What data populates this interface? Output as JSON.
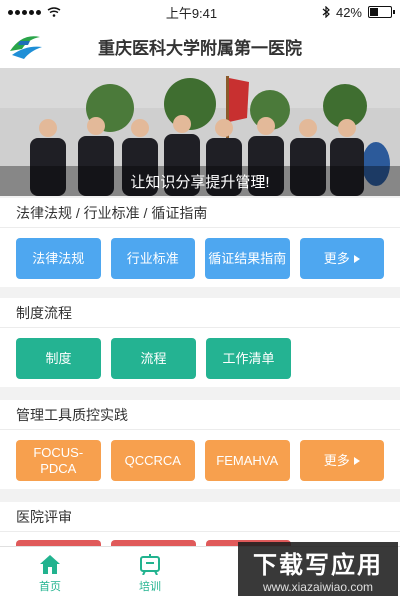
{
  "status": {
    "time": "上午9:41",
    "battery": "42%",
    "battery_fraction": 0.42
  },
  "header": {
    "title": "重庆医科大学附属第一医院"
  },
  "banner": {
    "caption": "让知识分享提升管理!"
  },
  "sections": {
    "law": {
      "title": "法律法规 / 行业标准 / 循证指南",
      "buttons": [
        "法律法规",
        "行业标准",
        "循证结果指南",
        "更多"
      ]
    },
    "process": {
      "title": "制度流程",
      "buttons": [
        "制度",
        "流程",
        "工作清单"
      ]
    },
    "tools": {
      "title": "管理工具质控实践",
      "buttons": [
        "FOCUS-PDCA",
        "QCCRCA",
        "FEMAHVA",
        "更多"
      ]
    },
    "review": {
      "title": "医院评审"
    }
  },
  "tabs": [
    {
      "label": "首页",
      "icon": "home-icon"
    },
    {
      "label": "培训",
      "icon": "training-icon"
    }
  ],
  "watermark": {
    "main": "下载写应用",
    "sub": "www.xiazaiwiao.com"
  },
  "colors": {
    "blue": "#4ea7f0",
    "green": "#24b392",
    "orange": "#f7a04e",
    "accent": "#22b38f"
  }
}
